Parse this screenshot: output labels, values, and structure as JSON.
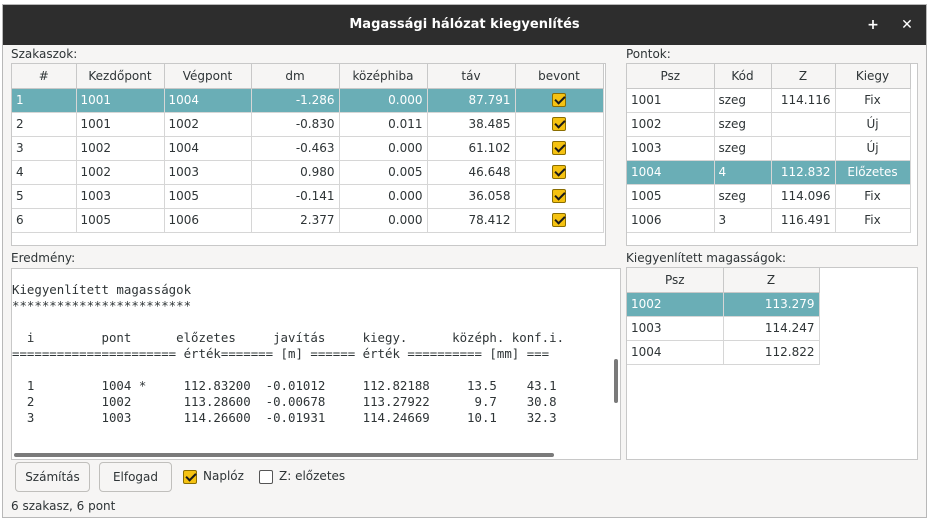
{
  "window": {
    "title": "Magassági hálózat kiegyenlítés"
  },
  "segments": {
    "label": "Szakaszok:",
    "columns": [
      "#",
      "Kezdőpont",
      "Végpont",
      "dm",
      "középhiba",
      "táv",
      "bevont"
    ],
    "rows": [
      [
        "1",
        "1001",
        "1004",
        "-1.286",
        "0.000",
        "87.791",
        true
      ],
      [
        "2",
        "1001",
        "1002",
        "-0.830",
        "0.011",
        "38.485",
        true
      ],
      [
        "3",
        "1002",
        "1004",
        "-0.463",
        "0.000",
        "61.102",
        true
      ],
      [
        "4",
        "1002",
        "1003",
        "0.980",
        "0.005",
        "46.648",
        true
      ],
      [
        "5",
        "1003",
        "1005",
        "-0.141",
        "0.000",
        "36.058",
        true
      ],
      [
        "6",
        "1005",
        "1006",
        "2.377",
        "0.000",
        "78.412",
        true
      ]
    ],
    "selected_row": 0
  },
  "points": {
    "label": "Pontok:",
    "columns": [
      "Psz",
      "Kód",
      "Z",
      "Kiegy"
    ],
    "rows": [
      [
        "1001",
        "szeg",
        "114.116",
        "Fix"
      ],
      [
        "1002",
        "szeg",
        "",
        "Új"
      ],
      [
        "1003",
        "szeg",
        "",
        "Új"
      ],
      [
        "1004",
        "4",
        "112.832",
        "Előzetes"
      ],
      [
        "1005",
        "szeg",
        "114.096",
        "Fix"
      ],
      [
        "1006",
        "3",
        "116.491",
        "Fix"
      ]
    ],
    "selected_row": 3
  },
  "result": {
    "label": "Eredmény:",
    "lines": [
      "Kiegyenlített magasságok",
      "************************",
      "",
      "  i         pont      előzetes     javítás     kiegy.      középh. konf.i.",
      "====================== érték======= [m] ====== érték ========== [mm] ===",
      "",
      "  1         1004 *     112.83200  -0.01012     112.82188     13.5    43.1",
      "  2         1002       113.28600  -0.00678     113.27922      9.7    30.8",
      "  3         1003       114.26600  -0.01931     114.24669     10.1    32.3"
    ]
  },
  "adjusted": {
    "label": "Kiegyenlített magasságok:",
    "columns": [
      "Psz",
      "Z"
    ],
    "rows": [
      [
        "1002",
        "113.279"
      ],
      [
        "1003",
        "114.247"
      ],
      [
        "1004",
        "112.822"
      ]
    ],
    "selected_row": 0
  },
  "buttons": {
    "calculate": "Számítás",
    "accept": "Elfogad"
  },
  "options": {
    "log_label": "Naplóz",
    "log_checked": true,
    "z_prelim_label": "Z: előzetes",
    "z_prelim_checked": false
  },
  "status": "6 szakasz, 6 pont",
  "colors": {
    "selection": "#6aaeb6",
    "checkbox": "#f5c211",
    "titlebar": "#2d2d2d"
  },
  "icons": {
    "maximize": "plus-icon",
    "close": "close-icon"
  }
}
